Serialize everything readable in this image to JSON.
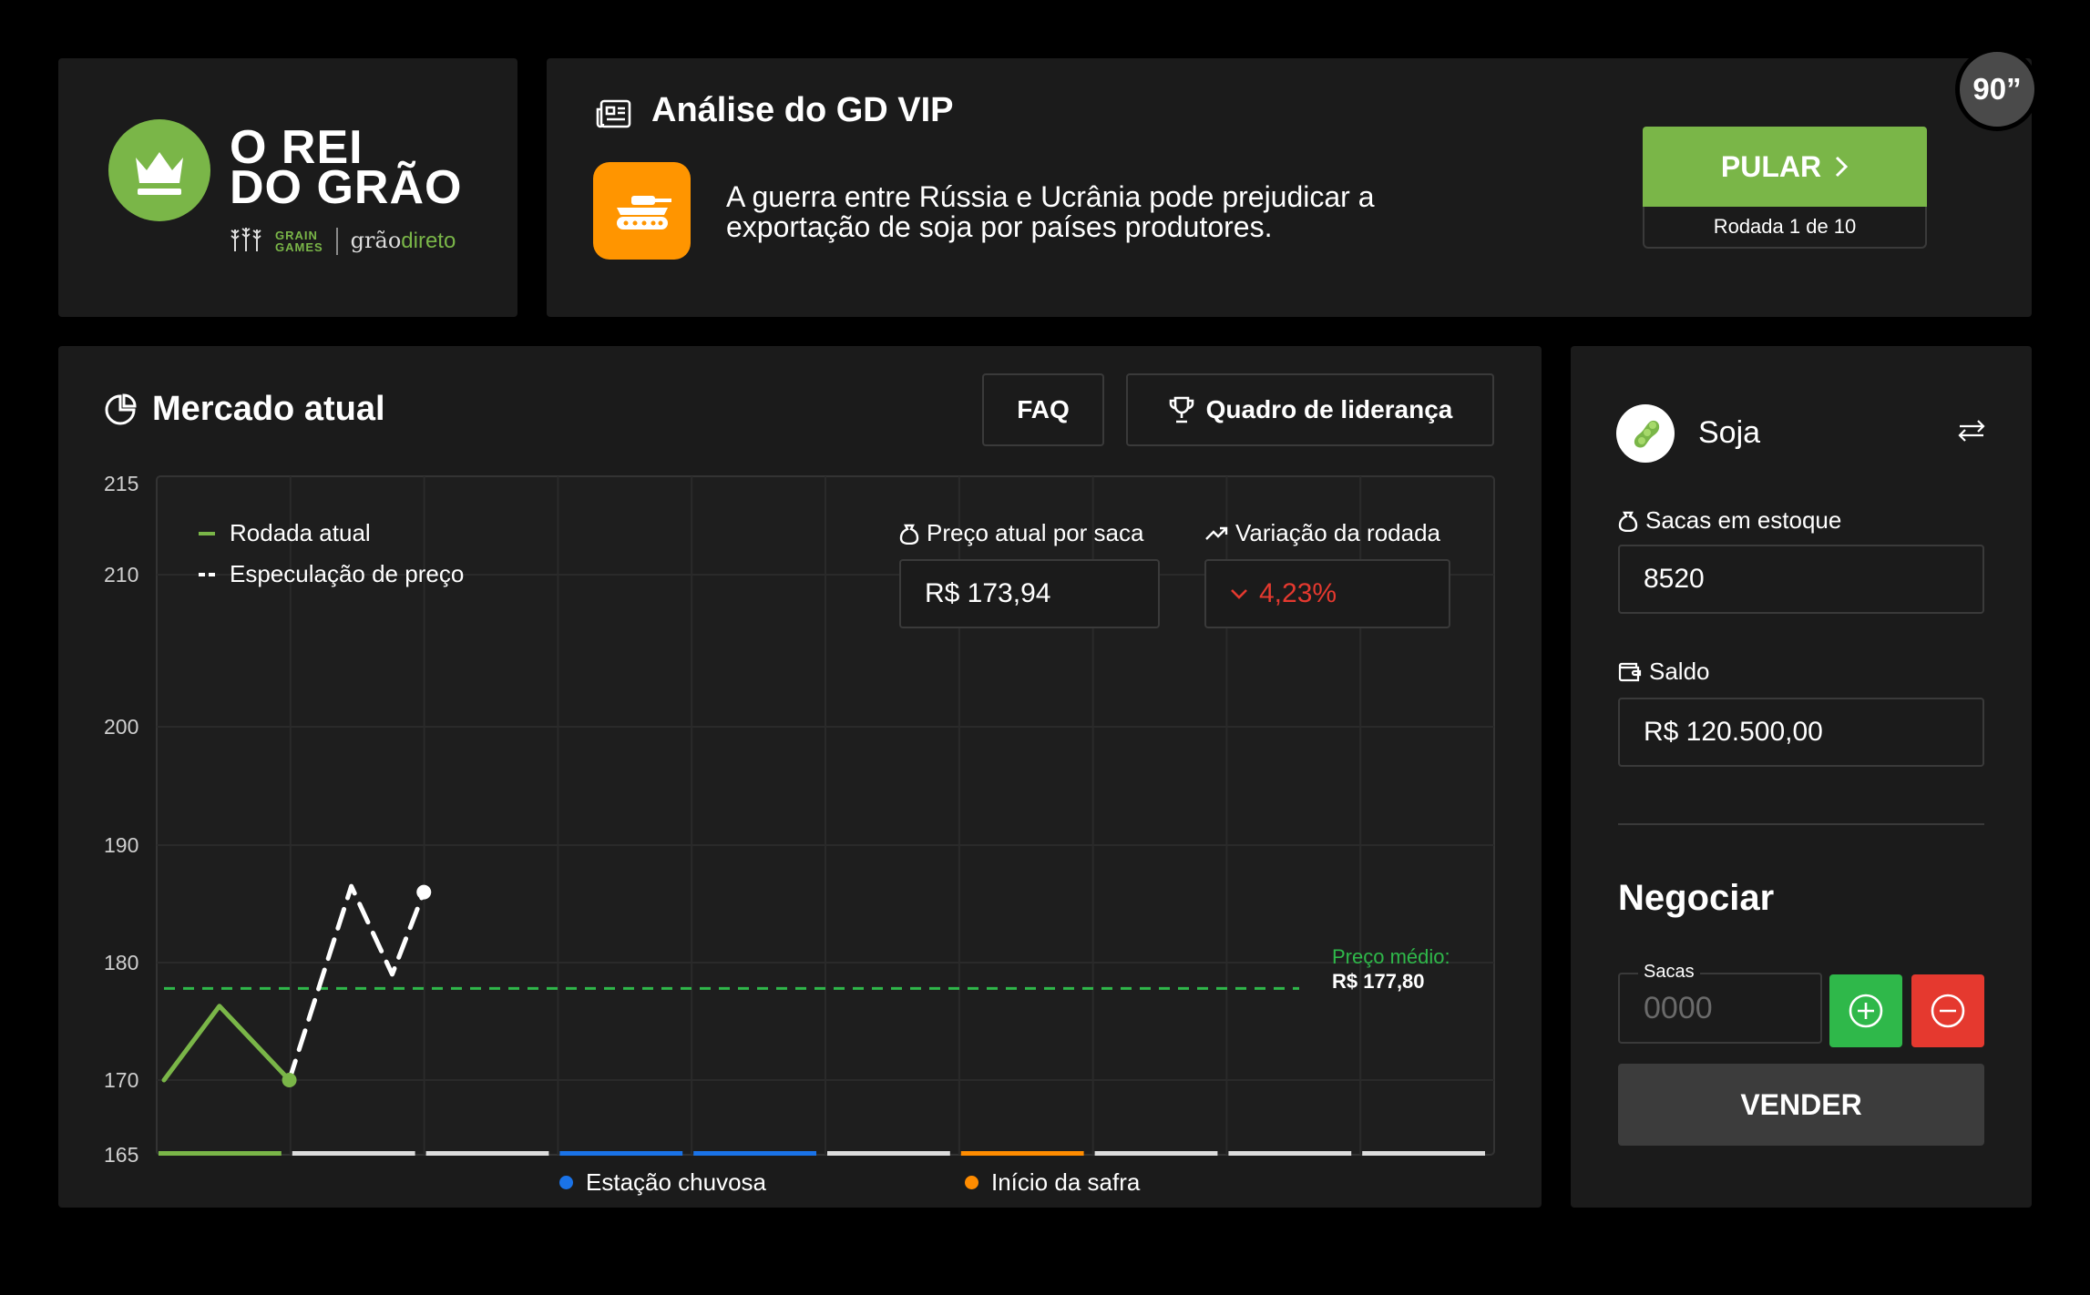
{
  "brand": {
    "title_line1": "O REI",
    "title_line2": "DO GRÃO",
    "partner1_line1": "GRAIN",
    "partner1_line2": "GAMES",
    "partner2_part1": "grão",
    "partner2_part2": "direto"
  },
  "news": {
    "title": "Análise do GD VIP",
    "text": "A guerra entre Rússia e Ucrânia pode prejudicar a exportação de soja por países produtores.",
    "icon": "tank-icon"
  },
  "skip": {
    "label": "PULAR",
    "round": "Rodada 1 de 10"
  },
  "timer": "90”",
  "market": {
    "title": "Mercado atual",
    "faq": "FAQ",
    "leaderboard": "Quadro de liderança",
    "price_label": "Preço atual por saca",
    "price_value": "R$ 173,94",
    "variation_label": "Variação da rodada",
    "variation_value": "4,23%",
    "legend_current": "Rodada atual",
    "legend_spec": "Especulação de preço",
    "avg_label": "Preço médio:",
    "avg_value": "R$ 177,80",
    "event_rain": "Estação chuvosa",
    "event_harvest": "Início da safra"
  },
  "chart_data": {
    "type": "line",
    "y_ticks": [
      165,
      170,
      180,
      190,
      200,
      210,
      215
    ],
    "ylim": [
      165,
      215
    ],
    "rounds": 10,
    "series": [
      {
        "name": "Rodada atual",
        "color": "#7ab648",
        "x": [
          0,
          0.42,
          0.95
        ],
        "y": [
          170,
          176.3,
          170
        ]
      },
      {
        "name": "Especulação de preço",
        "color": "#ffffff",
        "dashed": true,
        "x": [
          0.95,
          1.42,
          1.73,
          1.97
        ],
        "y": [
          170,
          186.5,
          179,
          186
        ]
      }
    ],
    "average": 177.8,
    "segments": [
      "#7ab648",
      "#dddddd",
      "#dddddd",
      "#1a73e8",
      "#1a73e8",
      "#dddddd",
      "#ff8c00",
      "#dddddd",
      "#dddddd",
      "#dddddd"
    ],
    "colors": {
      "green": "#7ab648",
      "avg_line": "#2fb84a",
      "rain": "#1a73e8",
      "harvest": "#ff8c00",
      "variation": "#e5392f"
    }
  },
  "side": {
    "commodity": "Soja",
    "stock_label": "Sacas em estoque",
    "stock_value": "8520",
    "balance_label": "Saldo",
    "balance_value": "R$ 120.500,00",
    "trade_title": "Negociar",
    "qty_label": "Sacas",
    "qty_placeholder": "0000",
    "sell": "VENDER"
  }
}
